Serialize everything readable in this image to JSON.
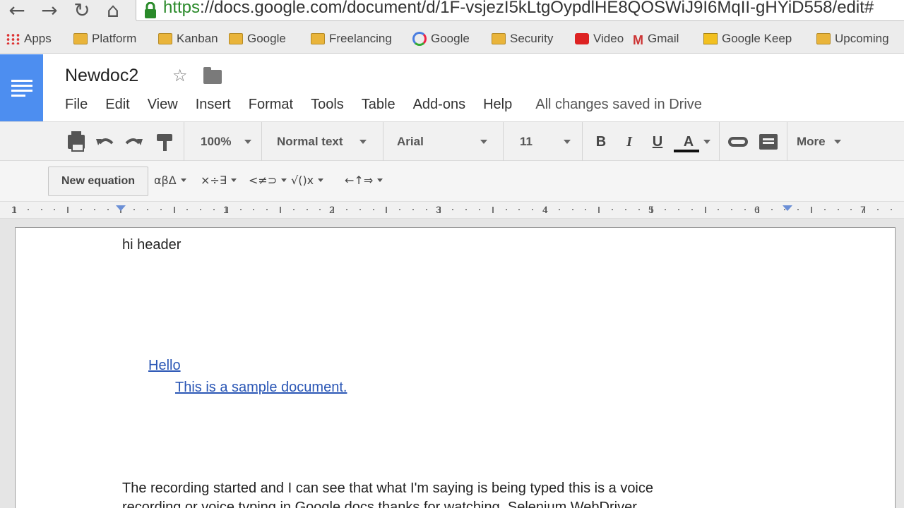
{
  "browser": {
    "url": "https://docs.google.com/document/d/1F-vsjezI5kLtgOypdlHE8QOSWiJ9I6MqII-gHYiD558/edit#",
    "bookmarks": [
      {
        "label": "Apps",
        "icon": "apps-grid-icon"
      },
      {
        "label": "Platform",
        "icon": "folder-icon"
      },
      {
        "label": "Kanban",
        "icon": "folder-icon"
      },
      {
        "label": "Google",
        "icon": "folder-icon"
      },
      {
        "label": "Freelancing",
        "icon": "folder-icon"
      },
      {
        "label": "Google",
        "icon": "google-icon"
      },
      {
        "label": "Security",
        "icon": "folder-icon"
      },
      {
        "label": "Video",
        "icon": "youtube-icon"
      },
      {
        "label": "Gmail",
        "icon": "gmail-icon"
      },
      {
        "label": "Google Keep",
        "icon": "keep-icon"
      },
      {
        "label": "Upcoming",
        "icon": "folder-icon"
      }
    ]
  },
  "docs": {
    "title": "Newdoc2",
    "menu": [
      "File",
      "Edit",
      "View",
      "Insert",
      "Format",
      "Tools",
      "Table",
      "Add-ons",
      "Help"
    ],
    "save_status": "All changes saved in Drive",
    "accent_color": "#4d8ef0"
  },
  "toolbar": {
    "zoom": "100%",
    "style": "Normal text",
    "font": "Arial",
    "font_size": "11",
    "bold": "B",
    "italic": "I",
    "underline": "U",
    "text_color": "A",
    "more": "More"
  },
  "equation_toolbar": {
    "new_equation": "New equation",
    "groups": [
      "αβΔ",
      "×÷∃",
      "<≠⊃",
      "√()x",
      "←↑⇒"
    ]
  },
  "ruler": {
    "labels": [
      "1",
      "1",
      "2",
      "3",
      "4",
      "5",
      "6",
      "7"
    ]
  },
  "document": {
    "header_text": "hi header",
    "link1": "Hello",
    "link2": "This is a sample document.",
    "body_text": "The recording started and I can see that what I'm saying is being typed this is a voice",
    "body_text_2": "recording or voice typing in Google docs thanks for watching. Selenium WebDriver"
  }
}
